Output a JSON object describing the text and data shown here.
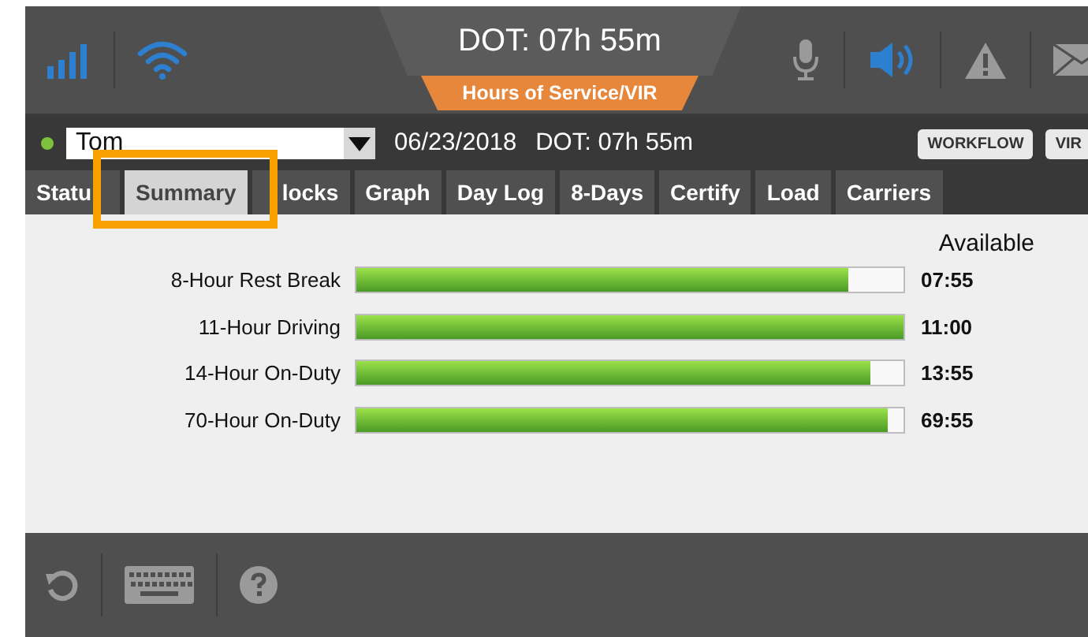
{
  "header": {
    "title": "DOT: 07h 55m",
    "subtitle": "Hours of Service/VIR"
  },
  "driver": {
    "name": "Tom",
    "date": "06/23/2018",
    "dot": "DOT: 07h 55m"
  },
  "buttons": [
    "WORKFLOW",
    "VIR"
  ],
  "tabs": [
    {
      "kind": "cutend",
      "label": "Statu",
      "selected": false
    },
    {
      "kind": "plain",
      "label": "Summary",
      "selected": true
    },
    {
      "kind": "cutstart",
      "label": "locks",
      "selected": false
    },
    {
      "kind": "plain",
      "label": "Graph",
      "selected": false
    },
    {
      "kind": "plain",
      "label": "Day Log",
      "selected": false
    },
    {
      "kind": "plain",
      "label": "8-Days",
      "selected": false
    },
    {
      "kind": "plain",
      "label": "Certify",
      "selected": false
    },
    {
      "kind": "plain",
      "label": "Load",
      "selected": false
    },
    {
      "kind": "plain",
      "label": "Carriers",
      "selected": false
    }
  ],
  "summary": {
    "heading": "Available",
    "rows": [
      {
        "label": "8-Hour Rest Break",
        "level": 0.9,
        "value": "07:55"
      },
      {
        "label": "11-Hour Driving",
        "level": 1.0,
        "value": "11:00"
      },
      {
        "label": "14-Hour On-Duty",
        "level": 0.94,
        "value": "13:55"
      },
      {
        "label": "70-Hour On-Duty",
        "level": 0.97,
        "value": "69:55"
      }
    ]
  }
}
